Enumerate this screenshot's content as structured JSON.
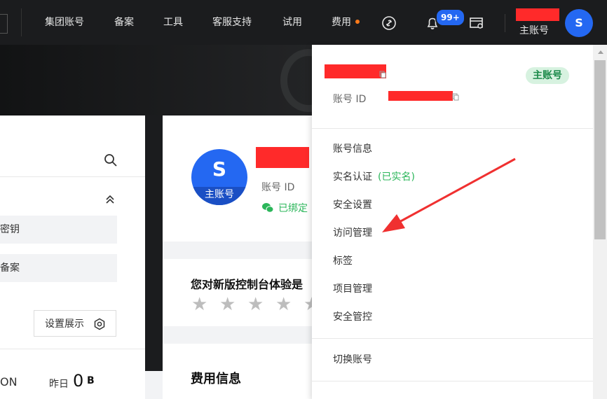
{
  "nav": {
    "items": [
      {
        "label": "集团账号"
      },
      {
        "label": "备案"
      },
      {
        "label": "工具"
      },
      {
        "label": "客服支持"
      },
      {
        "label": "试用"
      },
      {
        "label": "费用"
      }
    ],
    "notification_badge": "99+",
    "account_role": "主账号",
    "avatar_letter": "S",
    "icons": [
      "link-icon",
      "bell-icon",
      "console-icon"
    ]
  },
  "left_panel": {
    "items": [
      {
        "label": "密钥"
      },
      {
        "label": "备案"
      }
    ],
    "settings_button": "设置展示",
    "on_text": "ON",
    "yesterday_label": "昨日",
    "yesterday_value": "0",
    "yesterday_unit": "B"
  },
  "profile_card": {
    "avatar_letter": "S",
    "avatar_role": "主账号",
    "account_id_label": "账号 ID",
    "wechat_status": "已绑定"
  },
  "survey": {
    "question": "您对新版控制台体验是",
    "stars": [
      "★",
      "★",
      "★",
      "★",
      "★"
    ]
  },
  "fee": {
    "title": "费用信息"
  },
  "dropdown": {
    "role_badge": "主账号",
    "account_id_label": "账号 ID",
    "menu_items": [
      {
        "label": "账号信息"
      },
      {
        "label": "实名认证",
        "suffix": "(已实名)"
      },
      {
        "label": "安全设置"
      },
      {
        "label": "访问管理"
      },
      {
        "label": "标签"
      },
      {
        "label": "项目管理"
      },
      {
        "label": "安全管控"
      }
    ],
    "switch_account": "切换账号"
  },
  "colors": {
    "accent": "#2468f2",
    "success": "#2bb65a",
    "redaction": "#ff2a2a",
    "topbar": "#1b1c1e"
  }
}
